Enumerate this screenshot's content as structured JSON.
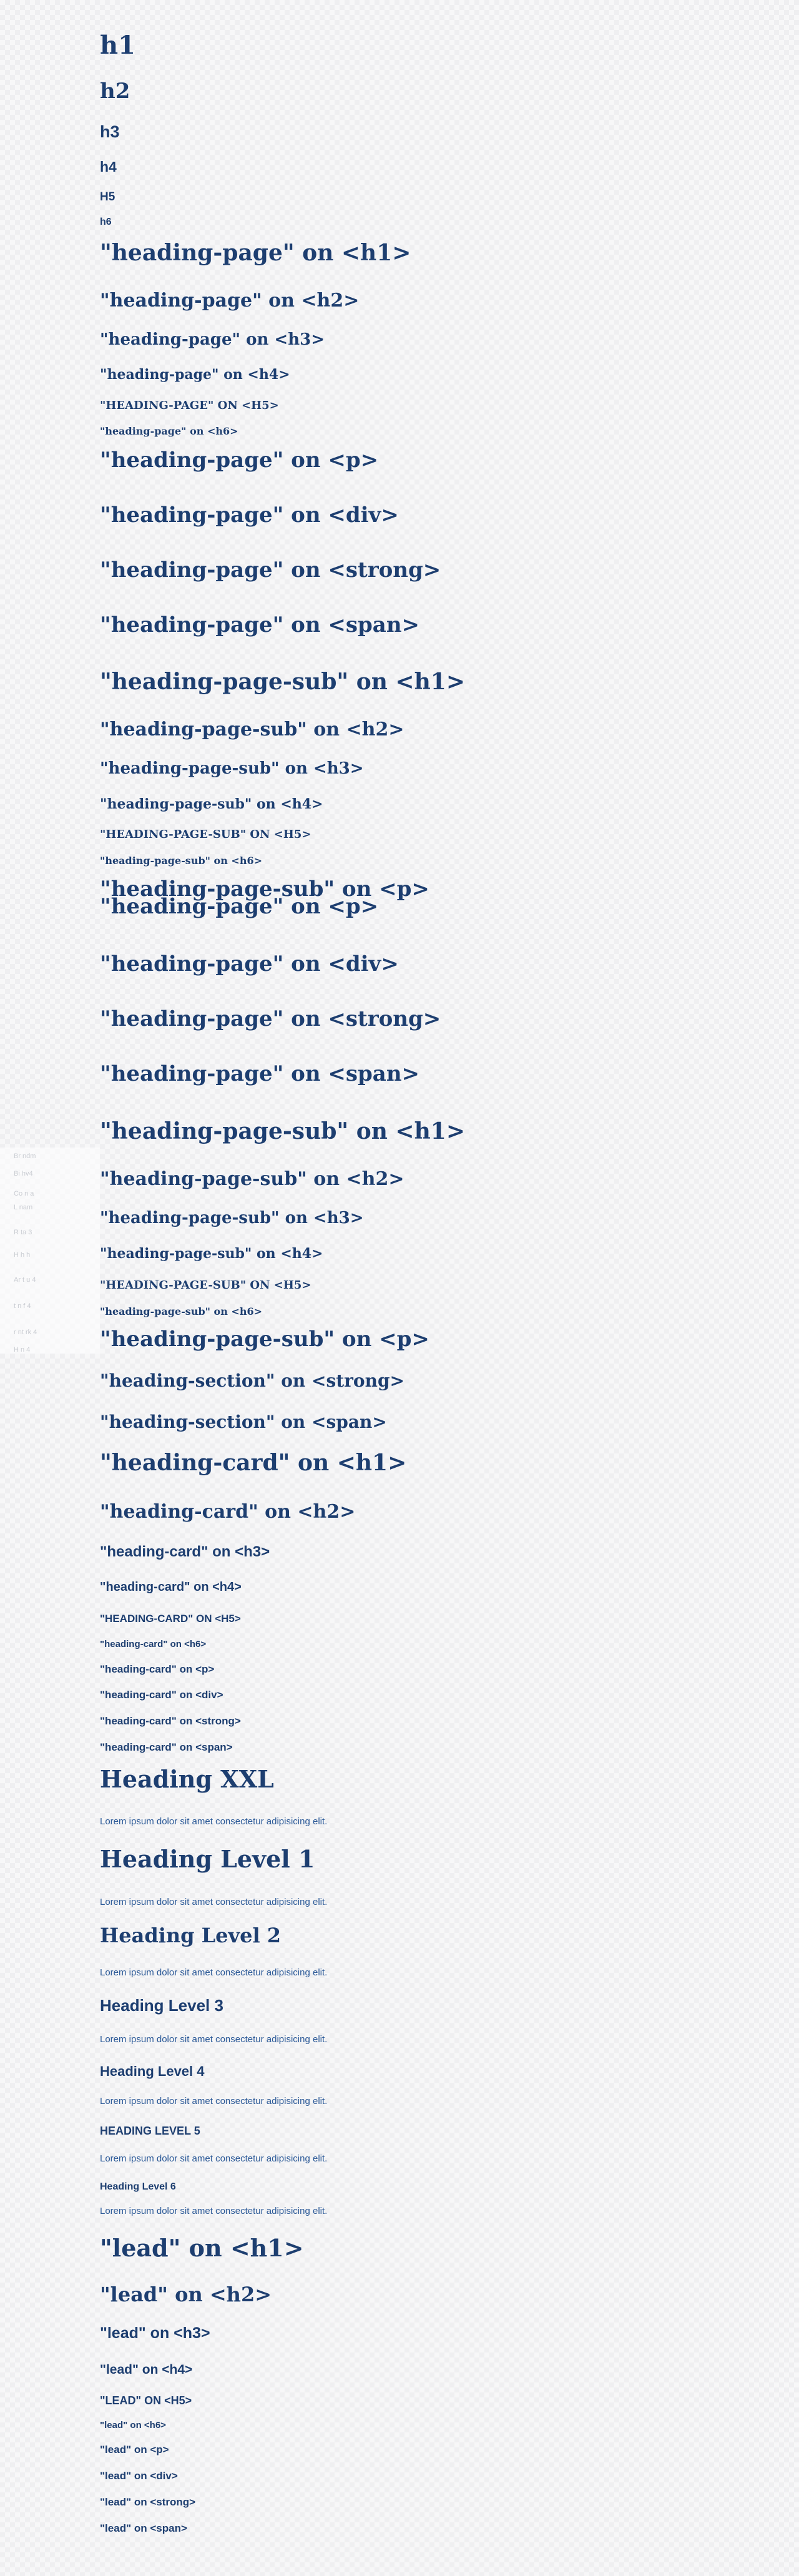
{
  "headings": {
    "basic": [
      "h1",
      "h2",
      "h3",
      "h4",
      "H5",
      "h6"
    ],
    "heading_page_1": [
      "\"heading-page\" on <h1>",
      "\"heading-page\" on <h2>",
      "\"heading-page\" on <h3>",
      "\"heading-page\" on <h4>",
      "\"HEADING-PAGE\" ON <H5>",
      "\"heading-page\" on <h6>",
      "\"heading-page\" on <p>",
      "\"heading-page\" on <div>",
      "\"heading-page\" on <strong>",
      "\"heading-page\" on <span>"
    ],
    "heading_page_sub_1": [
      "\"heading-page-sub\" on <h1>",
      "\"heading-page-sub\" on <h2>",
      "\"heading-page-sub\" on <h3>",
      "\"heading-page-sub\" on <h4>",
      "\"HEADING-PAGE-SUB\" ON <H5>",
      "\"heading-page-sub\" on <h6>",
      "\"heading-page-sub\" on <p>"
    ],
    "heading_page_2": [
      "\"heading-page\" on <p>",
      "\"heading-page\" on <div>",
      "\"heading-page\" on <strong>",
      "\"heading-page\" on <span>"
    ],
    "heading_page_sub_2": [
      "\"heading-page-sub\" on <h1>",
      "\"heading-page-sub\" on <h2>",
      "\"heading-page-sub\" on <h3>",
      "\"heading-page-sub\" on <h4>",
      "\"HEADING-PAGE-SUB\" ON <H5>",
      "\"heading-page-sub\" on <h6>",
      "\"heading-page-sub\" on <p>"
    ],
    "heading_section": [
      "\"heading-section\" on <strong>",
      "\"heading-section\" on <span>"
    ],
    "heading_card": [
      "\"heading-card\" on <h1>",
      "\"heading-card\" on <h2>",
      "\"heading-card\" on <h3>",
      "\"heading-card\" on <h4>",
      "\"HEADING-CARD\" ON <H5>",
      "\"heading-card\" on <h6>",
      "\"heading-card\" on <p>",
      "\"heading-card\" on <div>",
      "\"heading-card\" on <strong>",
      "\"heading-card\" on <span>"
    ],
    "levels": [
      {
        "title": "Heading XXL",
        "body": "Lorem ipsum dolor sit amet consectetur adipisicing elit."
      },
      {
        "title": "Heading Level 1",
        "body": "Lorem ipsum dolor sit amet consectetur adipisicing elit."
      },
      {
        "title": "Heading Level 2",
        "body": "Lorem ipsum dolor sit amet consectetur adipisicing elit."
      },
      {
        "title": "Heading Level 3",
        "body": "Lorem ipsum dolor sit amet consectetur adipisicing elit."
      },
      {
        "title": "Heading Level 4",
        "body": "Lorem ipsum dolor sit amet consectetur adipisicing elit."
      },
      {
        "title": "HEADING LEVEL 5",
        "body": "Lorem ipsum dolor sit amet consectetur adipisicing elit."
      },
      {
        "title": "Heading Level 6",
        "body": "Lorem ipsum dolor sit amet consectetur adipisicing elit."
      }
    ],
    "lead": [
      "\"lead\" on <h1>",
      "\"lead\" on <h2>",
      "\"lead\" on <h3>",
      "\"lead\" on <h4>",
      "\"LEAD\" ON <H5>",
      "\"lead\" on <h6>",
      "\"lead\" on <p>",
      "\"lead\" on <div>",
      "\"lead\" on <strong>",
      "\"lead\" on <span>"
    ]
  },
  "side_panel": {
    "items": [
      "Br ndm",
      "Bi hv4",
      "Co n a",
      "L nam",
      "R ta 3",
      "H h h",
      "Ar t u 4",
      "t n f 4",
      "r nt rk 4",
      "H n 4"
    ]
  },
  "colors": {
    "heading": "#1d3e70",
    "body_text": "#2c5a98",
    "background": "#f7f7f8"
  }
}
